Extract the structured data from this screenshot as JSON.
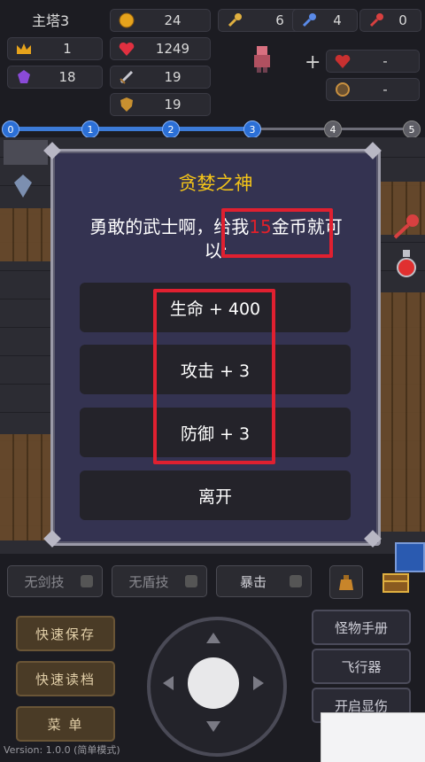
{
  "header": {
    "floor": "主塔3",
    "gold": "24",
    "key_yellow": "6",
    "key_blue": "4",
    "key_red": "0",
    "level": "1",
    "hp": "1249",
    "exp": "18",
    "atk": "19",
    "def": "19",
    "equip_slot1": "-",
    "equip_slot2": "-",
    "plus": "+"
  },
  "progress": {
    "nodes": [
      "0",
      "1",
      "2",
      "3",
      "4",
      "5"
    ],
    "current_index": 3
  },
  "dialog": {
    "title": "贪婪之神",
    "message_before": "勇敢的武士啊，给我",
    "message_number": "15",
    "message_after": "金币就可以:",
    "options": [
      "生命 + 400",
      "攻击 + 3",
      "防御 + 3"
    ],
    "leave": "离开"
  },
  "skills": {
    "sword": "无剑技",
    "shield": "无盾技",
    "crit": "暴击"
  },
  "left_buttons": [
    "快速保存",
    "快速读档",
    "菜  单"
  ],
  "right_buttons": [
    "怪物手册",
    "飞行器",
    "开启显伤"
  ],
  "version": "Version: 1.0.0 (简单模式)",
  "colors": {
    "dialog_bg": "#343351",
    "title": "#f5c518",
    "highlight": "#e02030",
    "number": "#e0202a"
  }
}
